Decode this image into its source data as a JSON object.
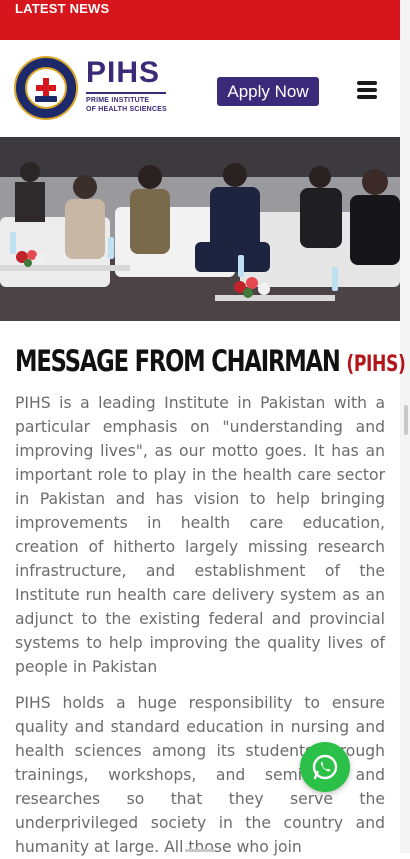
{
  "topbar": {
    "label": "LATEST NEWS"
  },
  "header": {
    "brand_name": "PIHS",
    "brand_tagline_1": "PRIME INSTITUTE",
    "brand_tagline_2": "OF HEALTH SCIENCES",
    "apply_label": "Apply Now"
  },
  "hero": {
    "icon": "event-photo"
  },
  "message": {
    "heading": "MESSAGE FROM CHAIRMAN",
    "heading_accent": "(PIHS)",
    "paragraph_1": "PIHS is a leading Institute in Pakistan with a particular emphasis on \"understanding and improving lives\", as our motto goes. It has an important role to play in the health care sector in Pakistan and has vision to help bringing improvements in health care education, creation of hitherto largely missing research infrastructure, and establishment of the Institute run health care delivery system as an adjunct to the existing federal and provincial systems to help improving the quality lives of people in Pakistan",
    "paragraph_2": "PIHS holds a huge responsibility to ensure quality and standard education in nursing and health sciences among its students through trainings, workshops, and seminars and researches so that they serve the underprivileged society in the country and humanity at large. All those who join"
  },
  "colors": {
    "topbar": "#d6161c",
    "brand": "#3a2a78",
    "apply_button": "#3b2a7a",
    "heading_accent": "#b2151a",
    "whatsapp": "#2bc047"
  },
  "icons": {
    "menu": "hamburger-icon",
    "whatsapp": "whatsapp-icon",
    "logo": "institute-seal-icon"
  }
}
